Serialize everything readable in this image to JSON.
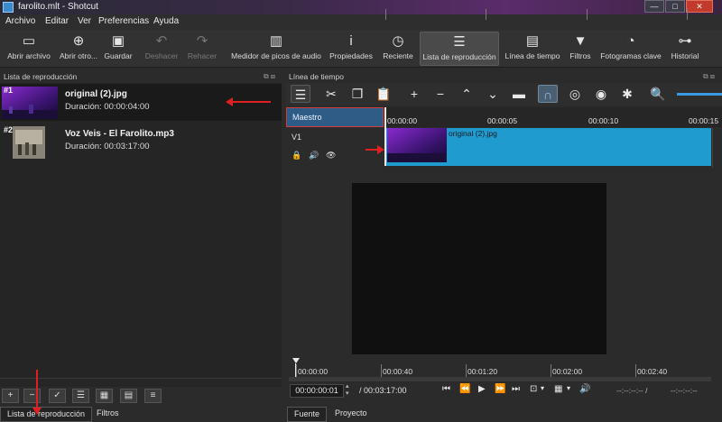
{
  "window": {
    "title": "farolito.mlt - Shotcut",
    "minimize": "—",
    "maximize": "□",
    "close": "✕"
  },
  "menu": [
    "Archivo",
    "Editar",
    "Ver",
    "Preferencias",
    "Ayuda"
  ],
  "toolbar": [
    {
      "label": "Abrir archivo",
      "icon": "folder-icon",
      "glyph": "▭"
    },
    {
      "label": "Abrir otro...",
      "icon": "open-other-icon",
      "glyph": "⊕"
    },
    {
      "label": "Guardar",
      "icon": "save-icon",
      "glyph": "▣"
    },
    {
      "label": "Deshacer",
      "icon": "undo-icon",
      "glyph": "↶"
    },
    {
      "label": "Rehacer",
      "icon": "redo-icon",
      "glyph": "↷"
    },
    {
      "label": "Medidor de picos de audio",
      "icon": "audio-meter-icon",
      "glyph": "▥"
    },
    {
      "label": "Propiedades",
      "icon": "info-icon",
      "glyph": "i"
    },
    {
      "label": "Reciente",
      "icon": "clock-icon",
      "glyph": "◷"
    },
    {
      "label": "Lista de reproducción",
      "icon": "list-icon",
      "glyph": "☰"
    },
    {
      "label": "Línea de tiempo",
      "icon": "timeline-icon",
      "glyph": "▤"
    },
    {
      "label": "Filtros",
      "icon": "filter-icon",
      "glyph": "▼"
    },
    {
      "label": "Fotogramas clave",
      "icon": "stopwatch-icon",
      "glyph": "◔"
    },
    {
      "label": "Historial",
      "icon": "history-icon",
      "glyph": "⊶"
    }
  ],
  "playlist": {
    "title": "Lista de reproducción",
    "items": [
      {
        "num": "#1",
        "name": "original (2).jpg",
        "duration": "Duración: 00:00:04:00"
      },
      {
        "num": "#2",
        "name": "Voz Veis - El Farolito.mp3",
        "duration": "Duración: 00:03:17:00"
      }
    ],
    "buttons": [
      "+",
      "−",
      "✓",
      "☰",
      "▦",
      "▤",
      "≡"
    ],
    "tabs": [
      "Lista de reproducción",
      "Filtros"
    ]
  },
  "timeline": {
    "title": "Línea de tiempo",
    "master_label": "Maestro",
    "track_label": "V1",
    "ruler": [
      "00:00:00",
      "00:00:05",
      "00:00:10",
      "00:00:15"
    ],
    "clip_name": "original (2).jpg",
    "tool_glyphs": [
      "☰",
      "✂",
      "❐",
      "📋",
      "+",
      "−",
      "⌃",
      "⌄",
      "▬",
      "∩",
      "◎",
      "◉",
      "✱",
      "🔍"
    ],
    "track_icons": [
      "🔒",
      "🔊",
      "👁"
    ]
  },
  "player": {
    "ruler": [
      "00:00:00",
      "00:00:40",
      "00:01:20",
      "00:02:00",
      "00:02:40"
    ],
    "timecode": "00:00:00:01",
    "total": "/ 00:03:17:00",
    "transport": [
      "⏮",
      "⏪",
      "▶",
      "⏩",
      "⏭",
      "⊡",
      "▾",
      "▦",
      "▾",
      "🔊"
    ],
    "in_point": "--:--:--:-- /",
    "out_point": "--:--:--:--",
    "tabs": [
      "Fuente",
      "Proyecto"
    ]
  },
  "colors": {
    "accent": "#1f9bd0",
    "master_header": "#2f5c87",
    "annotation": "#e02020"
  }
}
